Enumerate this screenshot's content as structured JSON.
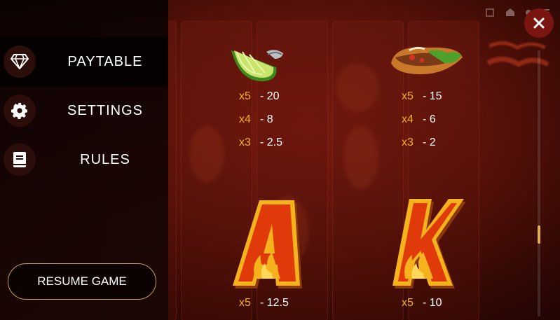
{
  "menu": {
    "items": [
      {
        "label": "PAYTABLE",
        "icon": "diamond-icon",
        "active": true
      },
      {
        "label": "SETTINGS",
        "icon": "gear-icon",
        "active": false
      },
      {
        "label": "RULES",
        "icon": "book-icon",
        "active": false
      }
    ],
    "resume_label": "RESUME GAME"
  },
  "paytable": {
    "symbols": [
      {
        "name": "lime",
        "icon": "lime-icon",
        "pays": [
          {
            "mult": "x5",
            "value": "- 20"
          },
          {
            "mult": "x4",
            "value": "- 8"
          },
          {
            "mult": "x3",
            "value": "- 2.5"
          }
        ]
      },
      {
        "name": "taco",
        "icon": "taco-icon",
        "pays": [
          {
            "mult": "x5",
            "value": "- 15"
          },
          {
            "mult": "x4",
            "value": "- 6"
          },
          {
            "mult": "x3",
            "value": "- 2"
          }
        ]
      },
      {
        "name": "A",
        "icon": "letter-a-icon",
        "letter": "A",
        "pays": [
          {
            "mult": "x5",
            "value": "- 12.5"
          }
        ]
      },
      {
        "name": "K",
        "icon": "letter-k-icon",
        "letter": "K",
        "pays": [
          {
            "mult": "x5",
            "value": "- 10"
          }
        ]
      }
    ]
  },
  "colors": {
    "multiplier": "#f2b320",
    "accent_border": "#c9a14a",
    "close_bg": "#7a1510"
  }
}
